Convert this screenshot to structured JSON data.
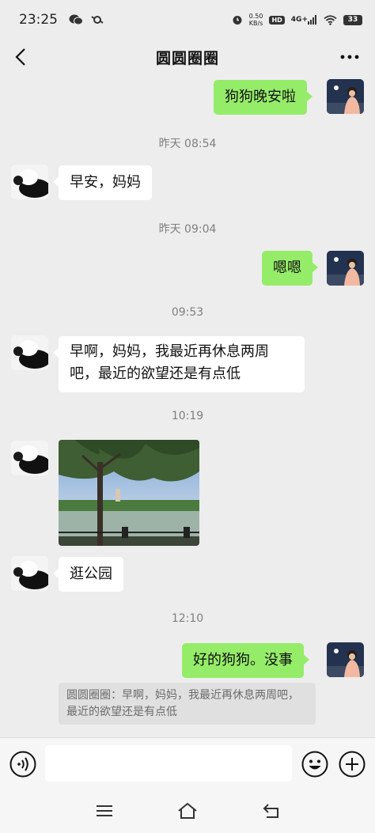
{
  "status_bar": {
    "time": "23:25",
    "net_speed_value": "0.50",
    "net_speed_unit": "KB/s",
    "hd": "HD",
    "signal": "4G+",
    "battery": "33"
  },
  "header": {
    "title": "圆圆圈圈"
  },
  "messages": [
    {
      "type": "text",
      "side": "out",
      "text": "狗狗晚安啦"
    },
    {
      "type": "time",
      "text": "昨天 08:54"
    },
    {
      "type": "text",
      "side": "in",
      "text": "早安，妈妈"
    },
    {
      "type": "time",
      "text": "昨天 09:04"
    },
    {
      "type": "text",
      "side": "out",
      "text": "嗯嗯"
    },
    {
      "type": "time",
      "text": "09:53"
    },
    {
      "type": "text",
      "side": "in",
      "text": "早啊，妈妈，我最近再休息两周吧，最近的欲望还是有点低"
    },
    {
      "type": "time",
      "text": "10:19"
    },
    {
      "type": "image",
      "side": "in"
    },
    {
      "type": "text",
      "side": "in",
      "text": "逛公园"
    },
    {
      "type": "time",
      "text": "12:10"
    },
    {
      "type": "text",
      "side": "out",
      "text": "好的狗狗。没事"
    }
  ],
  "quote": {
    "text": "圆圆圈圈：早啊，妈妈，我最近再休息两周吧，最近的欲望还是有点低"
  },
  "input": {
    "value": "",
    "placeholder": ""
  },
  "icons": {
    "back": "back-arrow-icon",
    "more": "more-icon",
    "voice": "voice-icon",
    "emoji": "emoji-icon",
    "plus": "plus-icon",
    "nav_menu": "menu-icon",
    "nav_home": "home-icon",
    "nav_back": "back-icon"
  },
  "colors": {
    "background": "#ededed",
    "bubble_out": "#95ec69",
    "bubble_in": "#ffffff",
    "timestamp": "#7f7f7f"
  }
}
